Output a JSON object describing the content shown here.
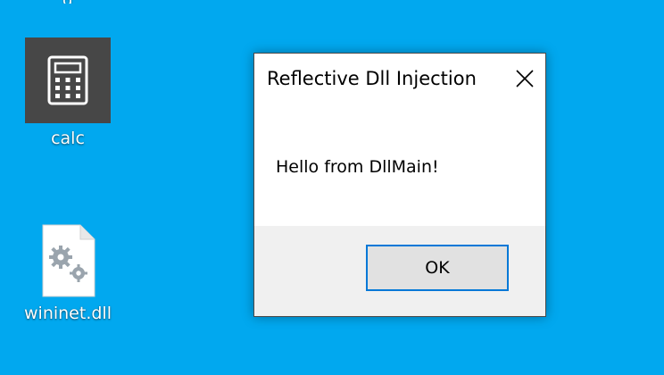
{
  "desktop": {
    "background_color": "#01a8ef",
    "top_fragment_text": "g",
    "icons": [
      {
        "label": "calc",
        "icon": "calculator-icon"
      },
      {
        "label": "wininet.dll",
        "icon": "dll-file-icon"
      }
    ]
  },
  "dialog": {
    "title": "Reflective Dll Injection",
    "message": "Hello from DllMain!",
    "ok_label": "OK",
    "close_icon": "close-icon",
    "accent_color": "#0078d7"
  }
}
